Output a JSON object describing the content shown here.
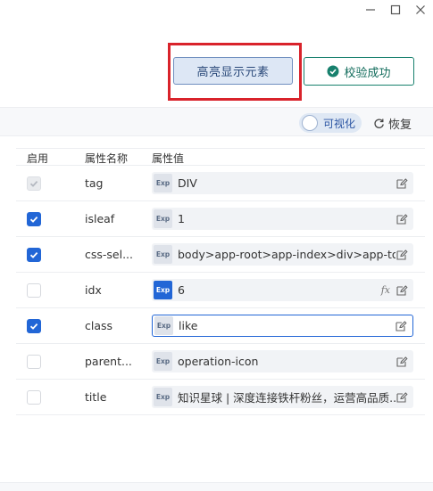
{
  "window": {
    "controls": [
      "minimize-icon",
      "maximize-icon",
      "close-icon"
    ]
  },
  "actions": {
    "highlight_label": "高亮显示元素",
    "verify_label": "校验成功"
  },
  "toolbar": {
    "visualize_label": "可视化",
    "restore_label": "恢复"
  },
  "table": {
    "headers": {
      "enabled": "启用",
      "name": "属性名称",
      "value": "属性值"
    },
    "exp_label": "Exp",
    "rows": [
      {
        "name": "tag",
        "value": "DIV",
        "checked": true,
        "disabled": true
      },
      {
        "name": "isleaf",
        "value": "1",
        "checked": true
      },
      {
        "name": "css-sel...",
        "value": "body>app-root>app-index>div>app-to...",
        "checked": true
      },
      {
        "name": "idx",
        "value": "6",
        "checked": false,
        "exp_active": true,
        "fx": "fx"
      },
      {
        "name": "class",
        "value": "like",
        "checked": true,
        "focused": true
      },
      {
        "name": "parent...",
        "value": "operation-icon",
        "checked": false
      },
      {
        "name": "title",
        "value": "知识星球 | 深度连接铁杆粉丝，运营高品质...",
        "checked": false
      }
    ]
  },
  "colors": {
    "primary": "#2266d6",
    "success": "#17806d",
    "highlight_frame": "#d9232b"
  }
}
